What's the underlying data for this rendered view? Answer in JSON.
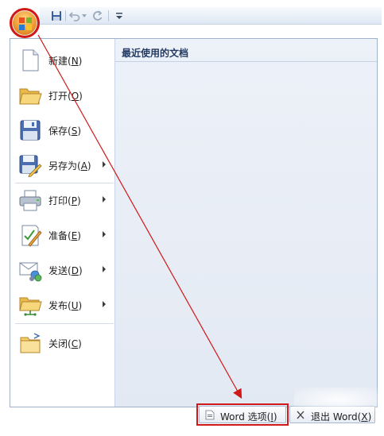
{
  "quick_access": {
    "icons": [
      "save-icon",
      "undo-icon",
      "redo-icon",
      "customize-dropdown-icon"
    ]
  },
  "office_button": {
    "icon": "office-logo-icon"
  },
  "menu": {
    "items": [
      {
        "label": "新建(",
        "key": "N",
        "suffix": ")",
        "icon": "new-document-icon",
        "submenu": false
      },
      {
        "label": "打开(",
        "key": "O",
        "suffix": ")",
        "icon": "open-folder-icon",
        "submenu": false
      },
      {
        "label": "保存(",
        "key": "S",
        "suffix": ")",
        "icon": "save-disk-icon",
        "submenu": false
      },
      {
        "label": "另存为(",
        "key": "A",
        "suffix": ")",
        "icon": "save-as-icon",
        "submenu": true
      },
      {
        "label": "打印(",
        "key": "P",
        "suffix": ")",
        "icon": "printer-icon",
        "submenu": true
      },
      {
        "label": "准备(",
        "key": "E",
        "suffix": ")",
        "icon": "prepare-icon",
        "submenu": true
      },
      {
        "label": "发送(",
        "key": "D",
        "suffix": ")",
        "icon": "send-icon",
        "submenu": true
      },
      {
        "label": "发布(",
        "key": "U",
        "suffix": ")",
        "icon": "publish-icon",
        "submenu": true
      },
      {
        "label": "关闭(",
        "key": "C",
        "suffix": ")",
        "icon": "close-folder-icon",
        "submenu": false
      }
    ],
    "recent_title": "最近使用的文档"
  },
  "footer": {
    "word_options": {
      "label": "Word 选项(",
      "key": "I",
      "suffix": ")"
    },
    "exit_word": {
      "label": "退出 Word(",
      "key": "X",
      "suffix": ")"
    }
  },
  "colors": {
    "annotation_red": "#d01818",
    "menu_border": "#9fb1cb",
    "recent_title": "#233a63"
  }
}
